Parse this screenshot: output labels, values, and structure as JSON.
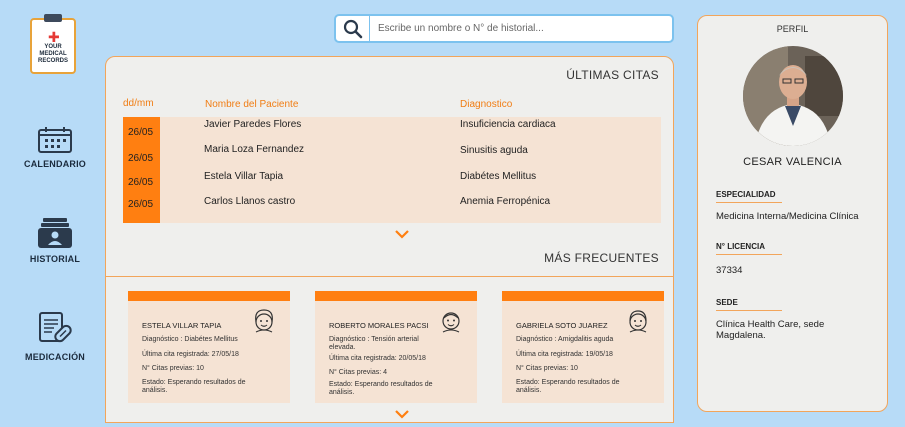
{
  "app": {
    "logo_text": "YOUR MEDICAL RECORDS"
  },
  "sidebar": {
    "items": [
      {
        "label": "CALENDARIO",
        "icon": "calendar-icon"
      },
      {
        "label": "HISTORIAL",
        "icon": "folder-icon"
      },
      {
        "label": "MEDICACIÓN",
        "icon": "prescription-icon"
      }
    ]
  },
  "search": {
    "placeholder": "Escribe un nombre o N° de historial...",
    "icon": "search-icon"
  },
  "recent": {
    "title": "ÚLTIMAS CITAS",
    "headers": {
      "date": "dd/mm",
      "name": "Nombre del Paciente",
      "diagnosis": "Diagnostico"
    },
    "rows": [
      {
        "date": "26/05",
        "name": "Javier Paredes Flores",
        "diagnosis": "Insuficiencia cardiaca"
      },
      {
        "date": "26/05",
        "name": "Maria Loza Fernandez",
        "diagnosis": "Sinusitis aguda"
      },
      {
        "date": "26/05",
        "name": "Estela Villar Tapia",
        "diagnosis": "Diabétes Mellitus"
      },
      {
        "date": "26/05",
        "name": "Carlos Llanos castro",
        "diagnosis": "Anemia Ferropénica"
      }
    ]
  },
  "frequent": {
    "title": "MÁS FRECUENTES",
    "cards": [
      {
        "name": "ESTELA VILLAR TAPIA",
        "diagnosis": "Diagnóstico : Diabétes Mellitus",
        "last_visit": "Última cita registrada: 27/05/18",
        "visits": "N° Citas previas: 10",
        "status": "Estado:  Esperando resultados de análisis."
      },
      {
        "name": "ROBERTO MORALES PACSI",
        "diagnosis": "Diagnóstico : Tensión arterial elevada.",
        "last_visit": "Última cita registrada: 20/05/18",
        "visits": "N° Citas previas:  4",
        "status": "Estado:  Esperando resultados de análisis."
      },
      {
        "name": "GABRIELA SOTO JUAREZ",
        "diagnosis": "Diagnóstico : Amigdalitis aguda",
        "last_visit": "Última cita registrada: 19/05/18",
        "visits": "N° Citas previas: 10",
        "status": "Estado:  Esperando resultados de análisis."
      }
    ]
  },
  "profile": {
    "title": "PERFIL",
    "name": "CESAR VALENCIA",
    "specialty_label": "ESPECIALIDAD",
    "specialty": "Medicina Interna/Medicina Clínica",
    "license_label": "N° LICENCIA",
    "license": "37334",
    "site_label": "SEDE",
    "site": "Clínica Health Care, sede Magdalena."
  },
  "colors": {
    "accent": "#ff7f11",
    "background": "#b7dbf7",
    "panel": "#efefed",
    "row_fill": "#f5e3d4"
  }
}
